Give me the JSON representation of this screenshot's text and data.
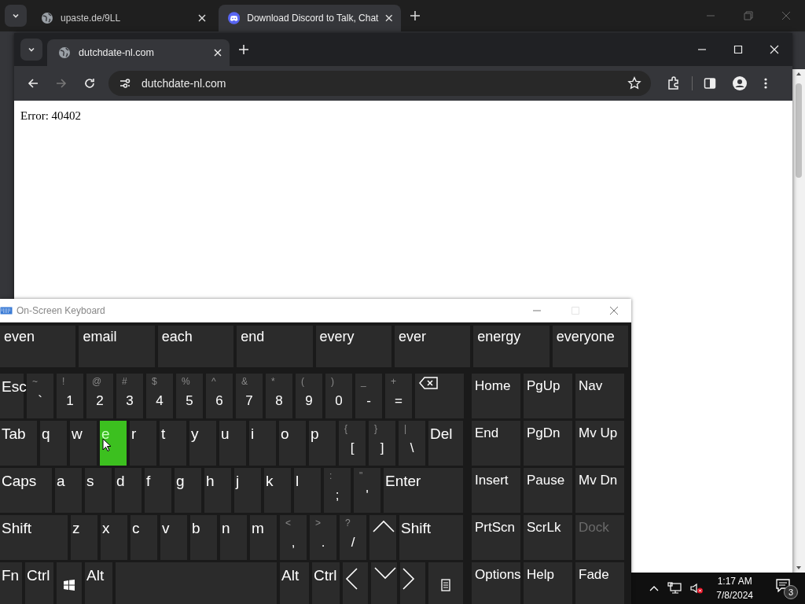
{
  "outer_browser": {
    "tabs": [
      {
        "title": "upaste.de/9LL",
        "kind": "globe",
        "selected": false
      },
      {
        "title": "Download Discord to Talk, Chat",
        "kind": "discord",
        "selected": true
      }
    ]
  },
  "browser": {
    "tab": {
      "title": "dutchdate-nl.com"
    },
    "address": "dutchdate-nl.com",
    "forward_disabled": true,
    "page_text": "Error: 40402"
  },
  "keyboard": {
    "title": "On-Screen Keyboard",
    "predictions": [
      "even",
      "email",
      "each",
      "end",
      "every",
      "ever",
      "energy",
      "everyone"
    ],
    "main_rows": [
      [
        {
          "kind": "text",
          "label": "Esc",
          "highlighted": false
        },
        {
          "kind": "text",
          "label": "`",
          "shifted": "~",
          "highlighted": false
        },
        {
          "kind": "text",
          "label": "1",
          "shifted": "!",
          "highlighted": false
        },
        {
          "kind": "text",
          "label": "2",
          "shifted": "@",
          "highlighted": false
        },
        {
          "kind": "text",
          "label": "3",
          "shifted": "#",
          "highlighted": false
        },
        {
          "kind": "text",
          "label": "4",
          "shifted": "$",
          "highlighted": false
        },
        {
          "kind": "text",
          "label": "5",
          "shifted": "%",
          "highlighted": false
        },
        {
          "kind": "text",
          "label": "6",
          "shifted": "^",
          "highlighted": false
        },
        {
          "kind": "text",
          "label": "7",
          "shifted": "&",
          "highlighted": false
        },
        {
          "kind": "text",
          "label": "8",
          "shifted": "*",
          "highlighted": false
        },
        {
          "kind": "text",
          "label": "9",
          "shifted": "(",
          "highlighted": false
        },
        {
          "kind": "text",
          "label": "0",
          "shifted": ")",
          "highlighted": false
        },
        {
          "kind": "text",
          "label": "-",
          "shifted": "_",
          "highlighted": false
        },
        {
          "kind": "text",
          "label": "=",
          "shifted": "+",
          "highlighted": false
        },
        {
          "kind": "backspace",
          "highlighted": false
        }
      ],
      [
        {
          "kind": "text",
          "label": "Tab",
          "highlighted": false
        },
        {
          "kind": "text",
          "label": "q",
          "highlighted": false
        },
        {
          "kind": "text",
          "label": "w",
          "highlighted": false
        },
        {
          "kind": "text",
          "label": "e",
          "highlighted": true
        },
        {
          "kind": "text",
          "label": "r",
          "highlighted": false
        },
        {
          "kind": "text",
          "label": "t",
          "highlighted": false
        },
        {
          "kind": "text",
          "label": "y",
          "highlighted": false
        },
        {
          "kind": "text",
          "label": "u",
          "highlighted": false
        },
        {
          "kind": "text",
          "label": "i",
          "highlighted": false
        },
        {
          "kind": "text",
          "label": "o",
          "highlighted": false
        },
        {
          "kind": "text",
          "label": "p",
          "highlighted": false
        },
        {
          "kind": "text",
          "label": "[",
          "shifted": "{",
          "highlighted": false
        },
        {
          "kind": "text",
          "label": "]",
          "shifted": "}",
          "highlighted": false
        },
        {
          "kind": "text",
          "label": "\\",
          "shifted": "|",
          "highlighted": false
        },
        {
          "kind": "text",
          "label": "Del",
          "highlighted": false
        }
      ],
      [
        {
          "kind": "text",
          "label": "Caps",
          "highlighted": false
        },
        {
          "kind": "text",
          "label": "a",
          "highlighted": false
        },
        {
          "kind": "text",
          "label": "s",
          "highlighted": false
        },
        {
          "kind": "text",
          "label": "d",
          "highlighted": false
        },
        {
          "kind": "text",
          "label": "f",
          "highlighted": false
        },
        {
          "kind": "text",
          "label": "g",
          "highlighted": false
        },
        {
          "kind": "text",
          "label": "h",
          "highlighted": false
        },
        {
          "kind": "text",
          "label": "j",
          "highlighted": false
        },
        {
          "kind": "text",
          "label": "k",
          "highlighted": false
        },
        {
          "kind": "text",
          "label": "l",
          "highlighted": false
        },
        {
          "kind": "text",
          "label": ";",
          "shifted": ":",
          "highlighted": false
        },
        {
          "kind": "text",
          "label": "'",
          "shifted": "\"",
          "highlighted": false
        },
        {
          "kind": "text",
          "label": "Enter",
          "highlighted": false
        }
      ],
      [
        {
          "kind": "text",
          "label": "Shift",
          "highlighted": false
        },
        {
          "kind": "text",
          "label": "z",
          "highlighted": false
        },
        {
          "kind": "text",
          "label": "x",
          "highlighted": false
        },
        {
          "kind": "text",
          "label": "c",
          "highlighted": false
        },
        {
          "kind": "text",
          "label": "v",
          "highlighted": false
        },
        {
          "kind": "text",
          "label": "b",
          "highlighted": false
        },
        {
          "kind": "text",
          "label": "n",
          "highlighted": false
        },
        {
          "kind": "text",
          "label": "m",
          "highlighted": false
        },
        {
          "kind": "text",
          "label": ",",
          "shifted": "<",
          "highlighted": false
        },
        {
          "kind": "text",
          "label": ".",
          "shifted": ">",
          "highlighted": false
        },
        {
          "kind": "text",
          "label": "/",
          "shifted": "?",
          "highlighted": false
        },
        {
          "kind": "up",
          "highlighted": false
        },
        {
          "kind": "text",
          "label": "Shift",
          "highlighted": false
        }
      ],
      [
        {
          "kind": "text",
          "label": "Fn",
          "highlighted": false
        },
        {
          "kind": "text",
          "label": "Ctrl",
          "highlighted": false
        },
        {
          "kind": "windows",
          "highlighted": false
        },
        {
          "kind": "text",
          "label": "Alt",
          "highlighted": false
        },
        {
          "kind": "space",
          "highlighted": false
        },
        {
          "kind": "text",
          "label": "Alt",
          "highlighted": false
        },
        {
          "kind": "text",
          "label": "Ctrl",
          "highlighted": false
        },
        {
          "kind": "left",
          "highlighted": false
        },
        {
          "kind": "down",
          "highlighted": false
        },
        {
          "kind": "right",
          "highlighted": false
        },
        {
          "kind": "menu",
          "highlighted": false
        }
      ]
    ],
    "nav_rows": [
      [
        {
          "label": "Home",
          "disabled": false
        },
        {
          "label": "PgUp",
          "disabled": false
        },
        {
          "label": "Nav",
          "disabled": false
        }
      ],
      [
        {
          "label": "End",
          "disabled": false
        },
        {
          "label": "PgDn",
          "disabled": false
        },
        {
          "label": "Mv Up",
          "disabled": false
        }
      ],
      [
        {
          "label": "Insert",
          "disabled": false
        },
        {
          "label": "Pause",
          "disabled": false
        },
        {
          "label": "Mv Dn",
          "disabled": false
        }
      ],
      [
        {
          "label": "PrtScn",
          "disabled": false
        },
        {
          "label": "ScrLk",
          "disabled": false
        },
        {
          "label": "Dock",
          "disabled": true
        }
      ],
      [
        {
          "label": "Options",
          "disabled": false
        },
        {
          "label": "Help",
          "disabled": false
        },
        {
          "label": "Fade",
          "disabled": false
        }
      ]
    ]
  },
  "taskbar": {
    "time": "1:17 AM",
    "date": "7/8/2024",
    "notification_count": "3",
    "volume_muted": true
  }
}
